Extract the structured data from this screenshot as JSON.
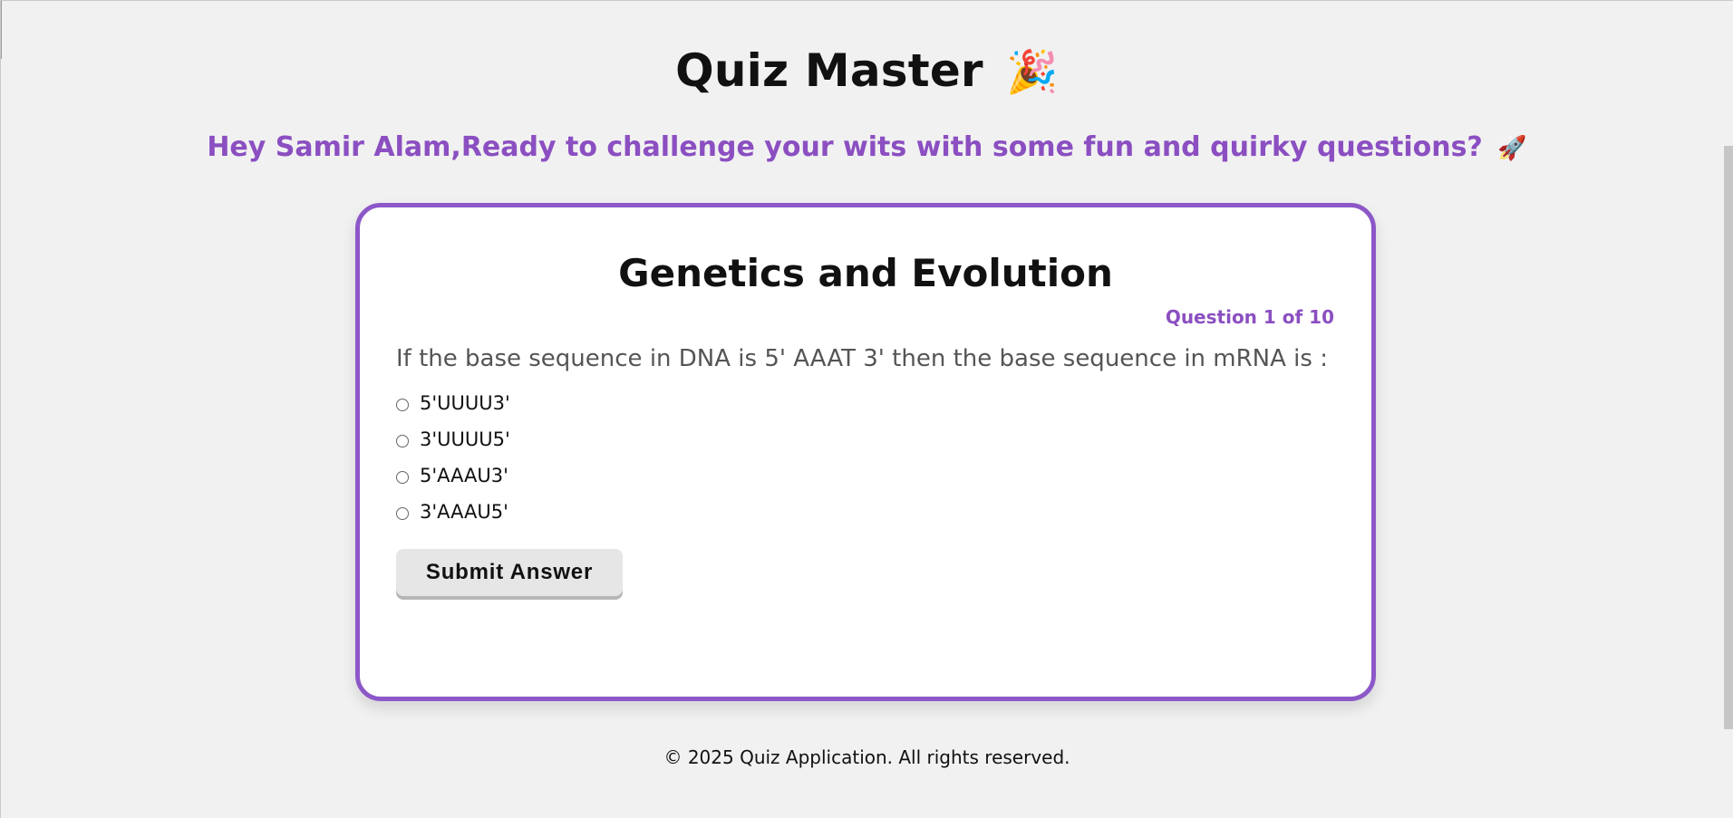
{
  "header": {
    "title": "Quiz Master",
    "title_icon": "🎉",
    "greeting": "Hey Samir Alam,Ready to challenge your wits with some fun and quirky questions?",
    "greeting_icon": "🚀"
  },
  "quiz": {
    "topic": "Genetics and Evolution",
    "question_counter": "Question 1 of 10",
    "question_text": "If the base sequence in DNA is 5' AAAT 3' then the base sequence in mRNA is :",
    "options": [
      "5'UUUU3'",
      "3'UUUU5'",
      "5'AAAU3'",
      "3'AAAU5'"
    ],
    "submit_label": "Submit Answer"
  },
  "footer": {
    "text": "© 2025 Quiz Application. All rights reserved."
  },
  "colors": {
    "accent_purple": "#8b4fc1",
    "card_border": "#8c58c8",
    "background": "#f1f1f2"
  }
}
